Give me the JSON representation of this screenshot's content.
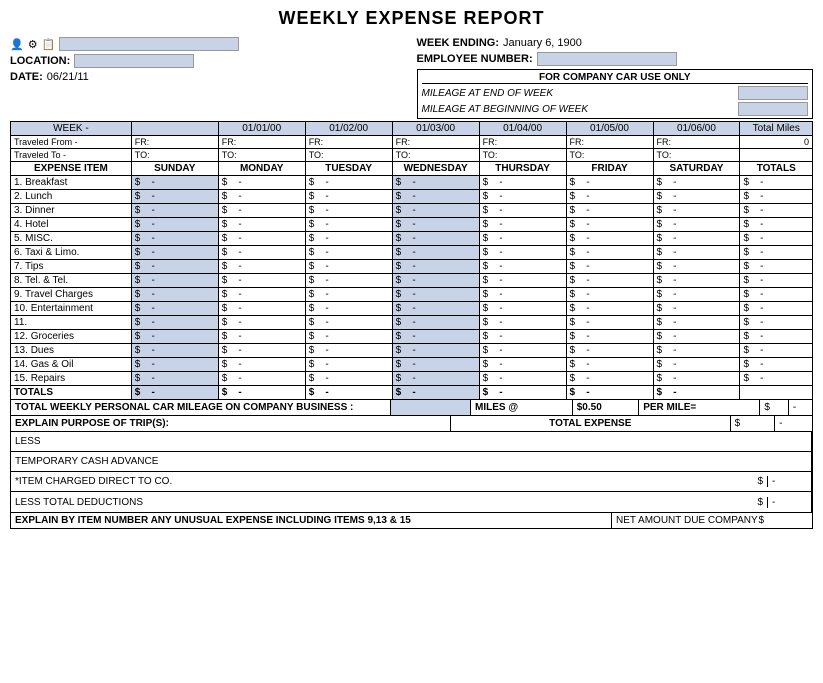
{
  "title": "WEEKLY EXPENSE REPORT",
  "header": {
    "week_ending_label": "WEEK ENDING:",
    "week_ending_value": "January 6, 1900",
    "employee_number_label": "EMPLOYEE NUMBER:",
    "location_label": "LOCATION:",
    "date_label": "DATE:",
    "date_value": "06/21/11",
    "company_car_title": "FOR COMPANY CAR USE ONLY",
    "mileage_end": "MILEAGE AT END OF WEEK",
    "mileage_begin": "MILEAGE AT BEGINNING OF WEEK",
    "week_label": "WEEK -",
    "total_miles_label": "Total Miles",
    "total_miles_value": "0"
  },
  "columns": {
    "dates": [
      "01/01/00",
      "01/02/00",
      "01/03/00",
      "01/04/00",
      "01/05/00",
      "01/06/00"
    ],
    "days": [
      "SUNDAY",
      "MONDAY",
      "TUESDAY",
      "WEDNESDAY",
      "THURSDAY",
      "FRIDAY",
      "SATURDAY"
    ]
  },
  "traveled_from": {
    "label": "Traveled From -",
    "prefix": "FR:"
  },
  "traveled_to": {
    "label": "Traveled To -",
    "prefix": "TO:"
  },
  "expense_header": {
    "item_label": "EXPENSE ITEM",
    "totals_label": "TOTALS"
  },
  "expense_items": [
    {
      "number": "1.",
      "name": "Breakfast"
    },
    {
      "number": "2.",
      "name": "Lunch"
    },
    {
      "number": "3.",
      "name": "Dinner"
    },
    {
      "number": "4.",
      "name": "Hotel"
    },
    {
      "number": "5.",
      "name": "MISC."
    },
    {
      "number": "6.",
      "name": "Taxi & Limo."
    },
    {
      "number": "7.",
      "name": "Tips"
    },
    {
      "number": "8.",
      "name": "Tel. & Tel."
    },
    {
      "number": "9.",
      "name": "Travel Charges"
    },
    {
      "number": "10.",
      "name": "Entertainment"
    },
    {
      "number": "11.",
      "name": ""
    },
    {
      "number": "12.",
      "name": "Groceries"
    },
    {
      "number": "13.",
      "name": "Dues"
    },
    {
      "number": "14.",
      "name": "Gas & Oil"
    },
    {
      "number": "15.",
      "name": "Repairs"
    }
  ],
  "totals_row_label": "TOTALS",
  "mileage_section": {
    "label": "TOTAL WEEKLY PERSONAL CAR MILEAGE ON COMPANY BUSINESS :",
    "miles_at": "MILES @",
    "rate": "$0.50",
    "per_mile": "PER MILE="
  },
  "explain_section": {
    "label": "EXPLAIN PURPOSE OF TRIP(S):",
    "total_expense_label": "TOTAL EXPENSE"
  },
  "deductions": {
    "less_label": "LESS",
    "temp_advance_label": "TEMPORARY CASH ADVANCE",
    "item_charged_label": "*ITEM CHARGED DIRECT TO CO.",
    "less_total_label": "LESS TOTAL DEDUCTIONS"
  },
  "bottom_section": {
    "explain_label": "EXPLAIN BY ITEM NUMBER ANY UNUSUAL EXPENSE INCLUDING ITEMS 9,13 & 15",
    "net_amount_label": "NET AMOUNT DUE COMPANY"
  },
  "dollar_sign": "$",
  "dash": "-"
}
